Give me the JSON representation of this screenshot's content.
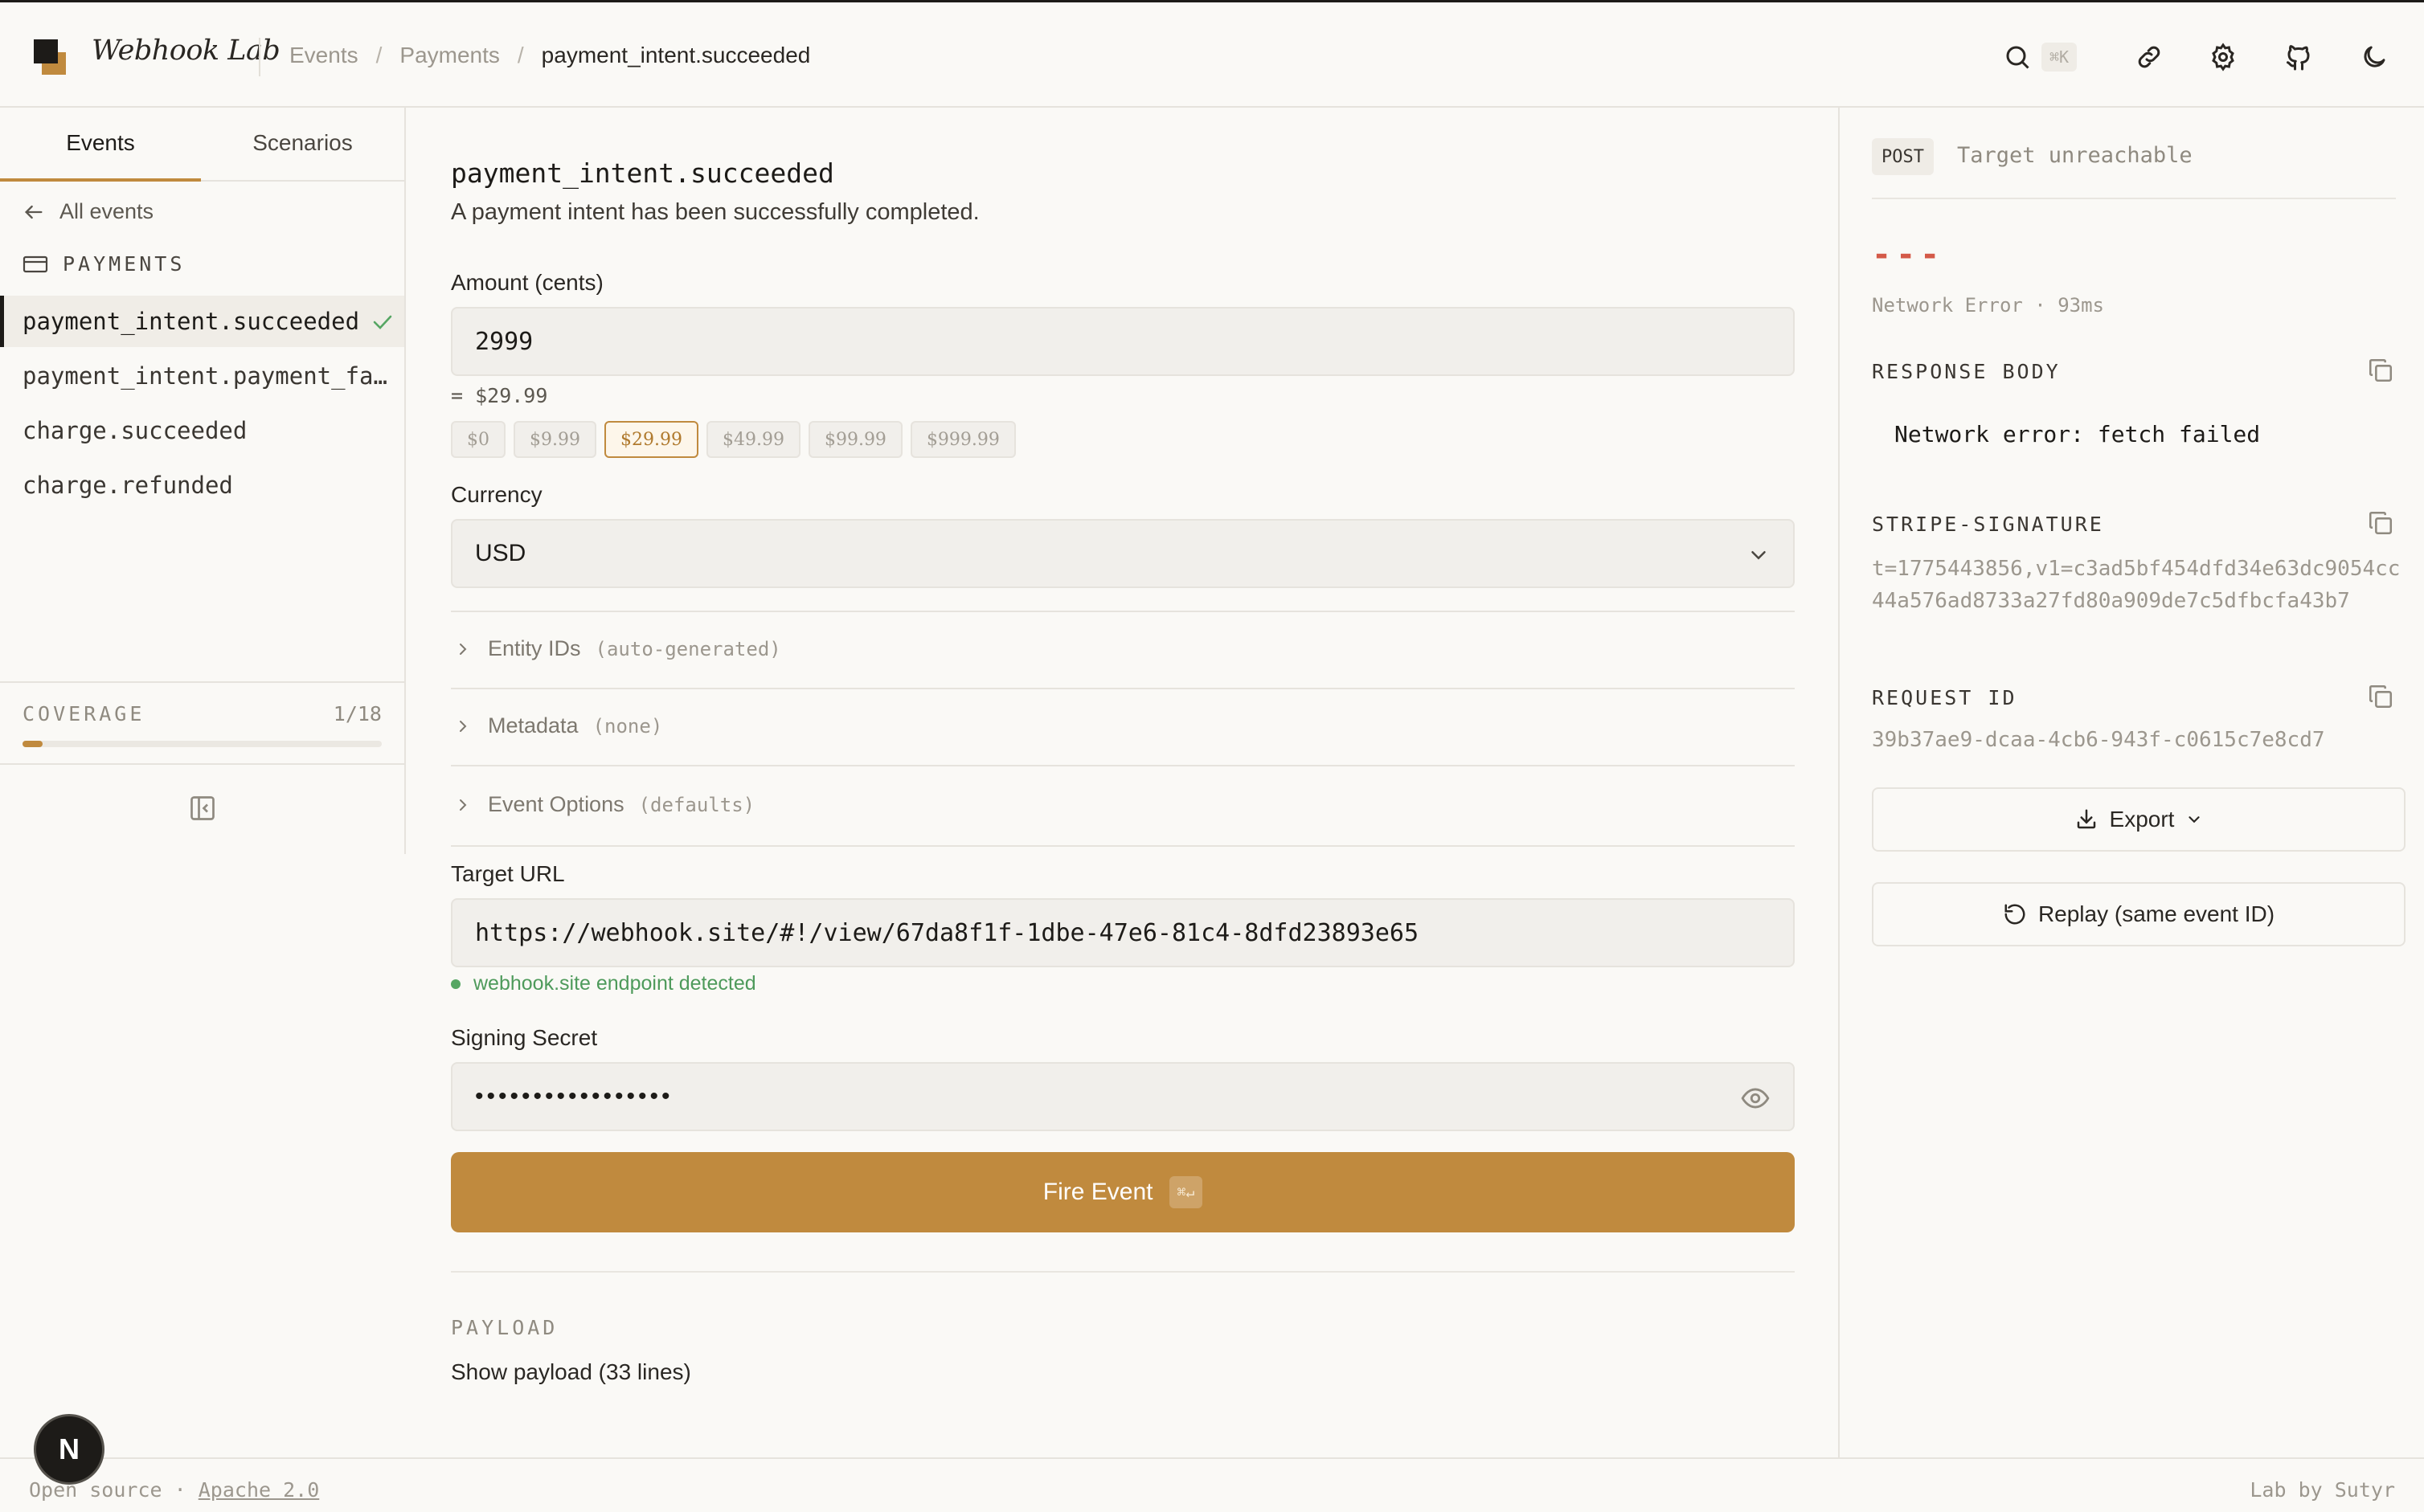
{
  "app": {
    "title": "Webhook Lab"
  },
  "breadcrumb": [
    "Events",
    "Payments",
    "payment_intent.succeeded"
  ],
  "header": {
    "search_shortcut": "⌘K",
    "icons": [
      "search-icon",
      "link-icon",
      "gear-icon",
      "github-icon",
      "moon-icon"
    ]
  },
  "sidebar": {
    "tabs": [
      {
        "label": "Events",
        "active": true
      },
      {
        "label": "Scenarios",
        "active": false
      }
    ],
    "back_label": "All events",
    "group_label": "PAYMENTS",
    "items": [
      {
        "label": "payment_intent.succeeded",
        "active": true,
        "done": true
      },
      {
        "label": "payment_intent.payment_fa…",
        "active": false,
        "done": false
      },
      {
        "label": "charge.succeeded",
        "active": false,
        "done": false
      },
      {
        "label": "charge.refunded",
        "active": false,
        "done": false
      }
    ],
    "coverage": {
      "label": "COVERAGE",
      "count": "1/18",
      "fraction": 0.0556
    }
  },
  "main": {
    "event_name": "payment_intent.succeeded",
    "event_description": "A payment intent has been successfully completed.",
    "amount": {
      "label": "Amount (cents)",
      "value": "2999",
      "converted": "= $29.99",
      "presets": [
        "$0",
        "$9.99",
        "$29.99",
        "$49.99",
        "$99.99",
        "$999.99"
      ],
      "selected_preset": "$29.99"
    },
    "currency": {
      "label": "Currency",
      "value": "USD"
    },
    "sections": [
      {
        "label": "Entity IDs",
        "hint": "(auto-generated)"
      },
      {
        "label": "Metadata",
        "hint": "(none)"
      },
      {
        "label": "Event Options",
        "hint": "(defaults)"
      }
    ],
    "target_url": {
      "label": "Target URL",
      "value": "https://webhook.site/#!/view/67da8f1f-1dbe-47e6-81c4-8dfd23893e65",
      "detected": "webhook.site endpoint detected"
    },
    "signing_secret": {
      "label": "Signing Secret",
      "masked": "•••••••••••••••••"
    },
    "fire_button": {
      "label": "Fire Event",
      "shortcut": "⌘↵",
      "color": "#c08a3e"
    },
    "payload": {
      "label": "PAYLOAD",
      "toggle": "Show payload (33 lines)"
    }
  },
  "response": {
    "method": "POST",
    "status": "Target unreachable",
    "code": "---",
    "meta": "Network Error · 93ms",
    "body_label": "RESPONSE BODY",
    "body": "Network error: fetch failed",
    "signature_label": "STRIPE-SIGNATURE",
    "signature": "t=1775443856,v1=c3ad5bf454dfd34e63dc9054cc44a576ad8733a27fd80a909de7c5dfbcfa43b7",
    "request_id_label": "REQUEST ID",
    "request_id": "39b37ae9-dcaa-4cb6-943f-c0615c7e8cd7",
    "export_label": "Export",
    "replay_label": "Replay (same event ID)",
    "error_color": "#d45a48"
  },
  "footer": {
    "left_text": "Open source ·",
    "license": "Apache 2.0",
    "right_text": "Lab by Sutyr"
  },
  "dev_badge": "N"
}
